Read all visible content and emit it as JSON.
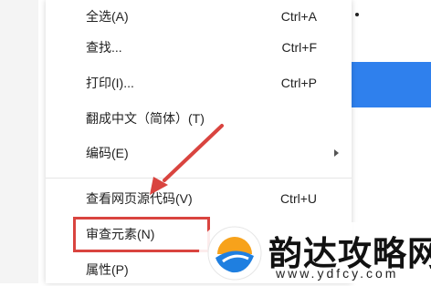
{
  "menu": {
    "items": [
      {
        "label": "全选(A)",
        "shortcut": "Ctrl+A"
      },
      {
        "label": "查找...",
        "shortcut": "Ctrl+F"
      },
      {
        "label": "打印(I)...",
        "shortcut": "Ctrl+P"
      },
      {
        "label": "翻成中文（简体）(T)",
        "shortcut": ""
      },
      {
        "label": "编码(E)",
        "shortcut": "",
        "has_submenu": true
      },
      {
        "label": "查看网页源代码(V)",
        "shortcut": "Ctrl+U"
      },
      {
        "label": "审查元素(N)",
        "shortcut": "",
        "highlighted": true
      },
      {
        "label": "属性(P)",
        "shortcut": ""
      }
    ]
  },
  "annotation": {
    "color": "#d9443f",
    "icon": "red-arrow-icon"
  },
  "watermark": {
    "title": "韵达攻略网",
    "url": "www.ydfcy.com",
    "icon": "logo-icon"
  },
  "colors": {
    "accent_blue": "#2f80ed",
    "annotation_red": "#d9443f",
    "logo_orange": "#f7a21b",
    "logo_blue": "#1f7fe0"
  }
}
